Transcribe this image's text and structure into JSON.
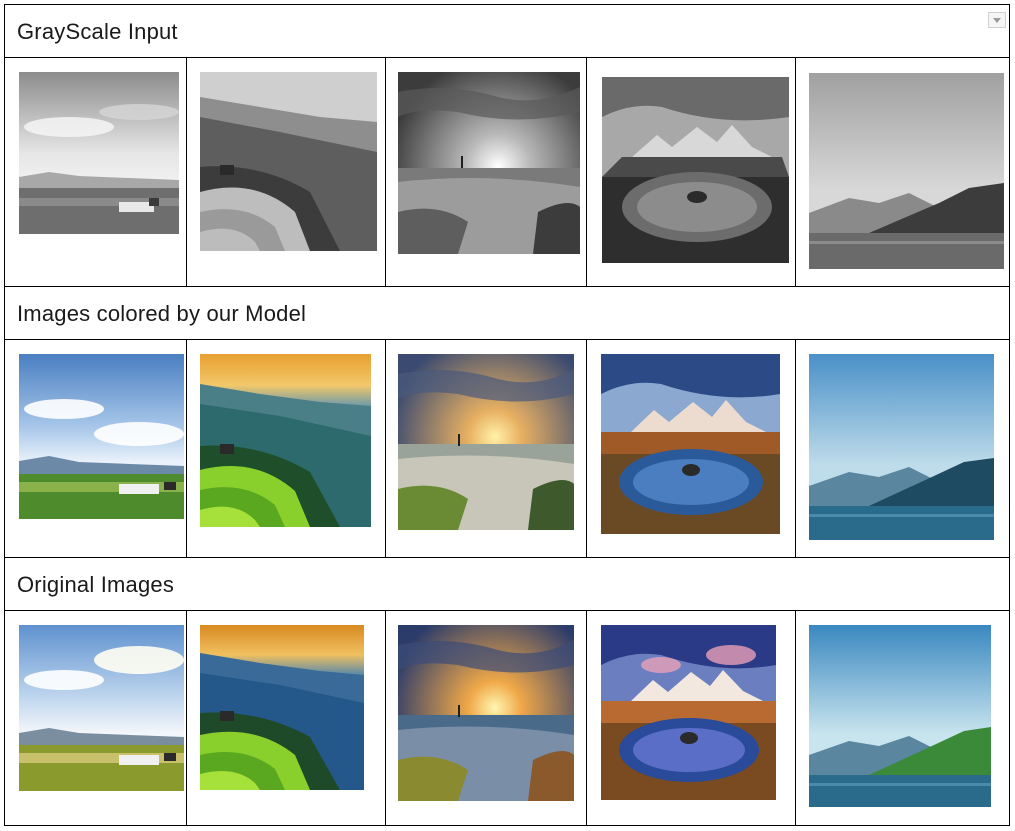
{
  "rows": [
    {
      "title": "GrayScale Input"
    },
    {
      "title": "Images colored by our Model"
    },
    {
      "title": "Original Images"
    }
  ],
  "images": {
    "gray": [
      "field-landscape-grayscale",
      "rice-terraces-grayscale",
      "sunset-sea-rocks-grayscale",
      "mountain-pond-grayscale",
      "mountain-lake-grayscale"
    ],
    "model": [
      "field-landscape-colored",
      "rice-terraces-colored",
      "sunset-sea-rocks-colored",
      "mountain-pond-colored",
      "mountain-lake-colored"
    ],
    "orig": [
      "field-landscape-original",
      "rice-terraces-original",
      "sunset-sea-rocks-original",
      "mountain-pond-original",
      "mountain-lake-original"
    ]
  }
}
